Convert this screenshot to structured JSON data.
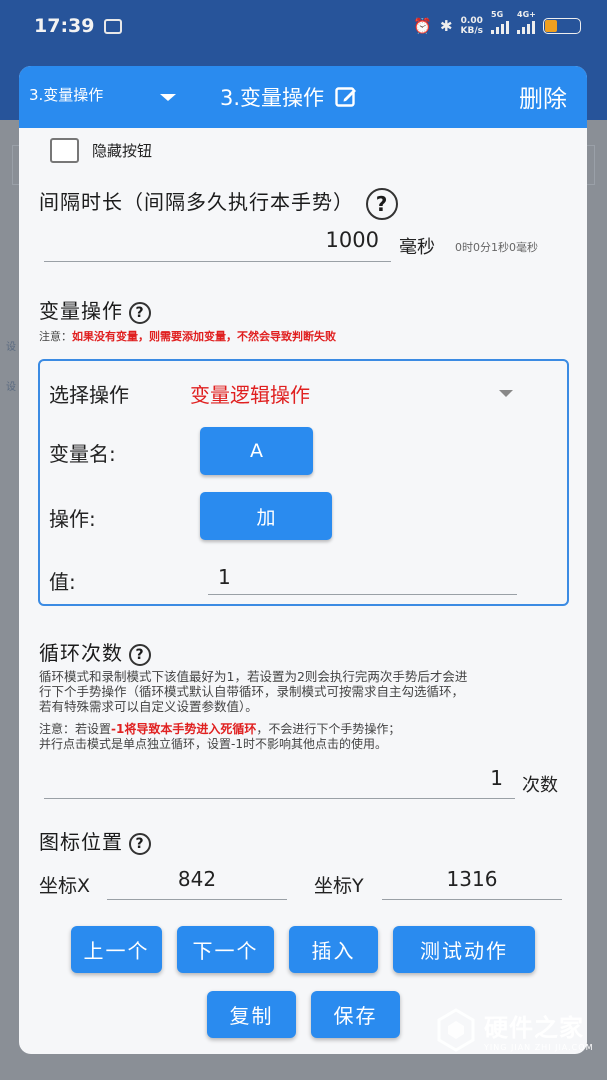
{
  "status_bar": {
    "time": "17:39",
    "net_speed_top": "0.00",
    "net_speed_bottom": "KB/s",
    "sim1_label": "5G",
    "sim2_label": "4G+",
    "battery_level": 0.35
  },
  "header": {
    "select_value": "3.变量操作",
    "title": "3.变量操作",
    "delete_label": "删除"
  },
  "hide_button": {
    "label": "隐藏按钮",
    "checked": false
  },
  "interval": {
    "title": "间隔时长（间隔多久执行本手势）",
    "value": "1000",
    "unit": "毫秒",
    "readable": "0时0分1秒0毫秒"
  },
  "variable_op": {
    "title": "变量操作",
    "note_prefix": "注意：",
    "note_red": "如果没有变量，则需要添加变量，不然会导致判断失败",
    "select_label": "选择操作",
    "select_value": "变量逻辑操作",
    "var_name_label": "变量名:",
    "var_name_value": "A",
    "operation_label": "操作:",
    "operation_value": "加",
    "value_label": "值:",
    "value": "1"
  },
  "loop": {
    "title": "循环次数",
    "desc_line1": "循环模式和录制模式下该值最好为1，若设置为2则会执行完两次手势后才会进",
    "desc_line2": "行下个手势操作（循环模式默认自带循环，录制模式可按需求自主勾选循环，",
    "desc_line3": "若有特殊需求可以自定义设置参数值）。",
    "note_prefix": "注意：若设置",
    "note_red": "-1将导致本手势进入死循环",
    "note_suffix": "，不会进行下个手势操作；",
    "note_line2": "并行点击模式是单点独立循环，设置-1时不影响其他点击的使用。",
    "value": "1",
    "unit": "次数"
  },
  "icon_position": {
    "title": "图标位置",
    "x_label": "坐标X",
    "x_value": "842",
    "y_label": "坐标Y",
    "y_value": "1316"
  },
  "buttons": {
    "prev": "上一个",
    "next": "下一个",
    "insert": "插入",
    "test": "测试动作",
    "copy": "复制",
    "save": "保存"
  },
  "watermark": {
    "main": "硬件之家",
    "sub": "YING JIAN ZHI JIA.COM"
  },
  "colors": {
    "accent": "#2a8bef",
    "warning": "#e02020",
    "header_bg": "#2a8bef"
  }
}
